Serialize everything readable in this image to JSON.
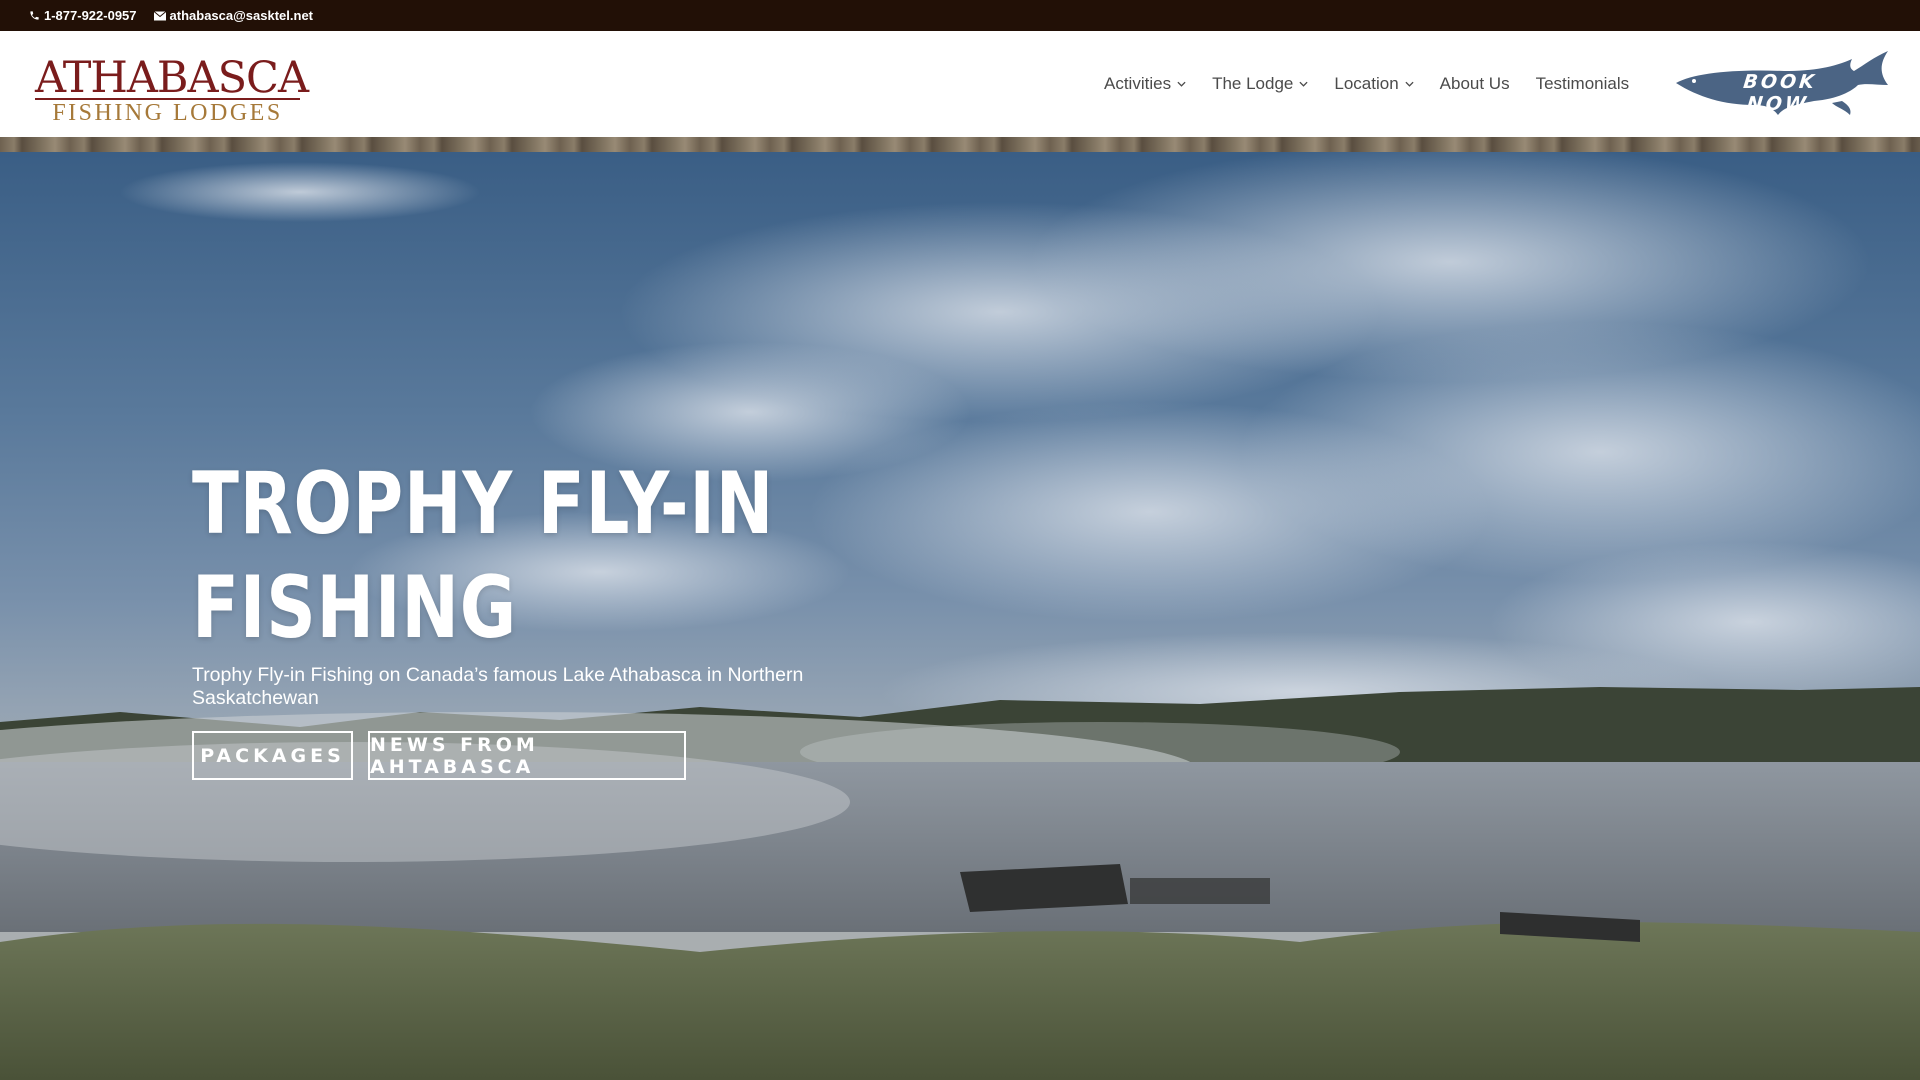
{
  "topbar": {
    "phone": "1-877-922-0957",
    "email": "athabasca@sasktel.net",
    "phone_icon": "phone-icon",
    "email_icon": "envelope-icon"
  },
  "logo": {
    "top": "ATHABASCA",
    "bottom": "FISHING LODGES"
  },
  "nav": {
    "items": [
      {
        "label": "Activities",
        "has_dropdown": true
      },
      {
        "label": "The Lodge",
        "has_dropdown": true
      },
      {
        "label": "Location",
        "has_dropdown": true
      },
      {
        "label": "About Us",
        "has_dropdown": false
      },
      {
        "label": "Testimonials",
        "has_dropdown": false
      }
    ],
    "book_now": "BOOK NOW"
  },
  "hero": {
    "title": "TROPHY FLY-IN FISHING",
    "subtitle": "Trophy Fly-in Fishing on Canada’s famous Lake Athabasca in Northern Saskatchewan",
    "buttons": [
      {
        "label": "PACKAGES"
      },
      {
        "label": "NEWS FROM AHTABASCA"
      }
    ]
  },
  "colors": {
    "topbar_bg": "#221006",
    "logo_red": "#7a1c1c",
    "logo_gold": "#a67939",
    "nav_text": "#4b4b4b",
    "book_now_fish": "#4b6484"
  }
}
